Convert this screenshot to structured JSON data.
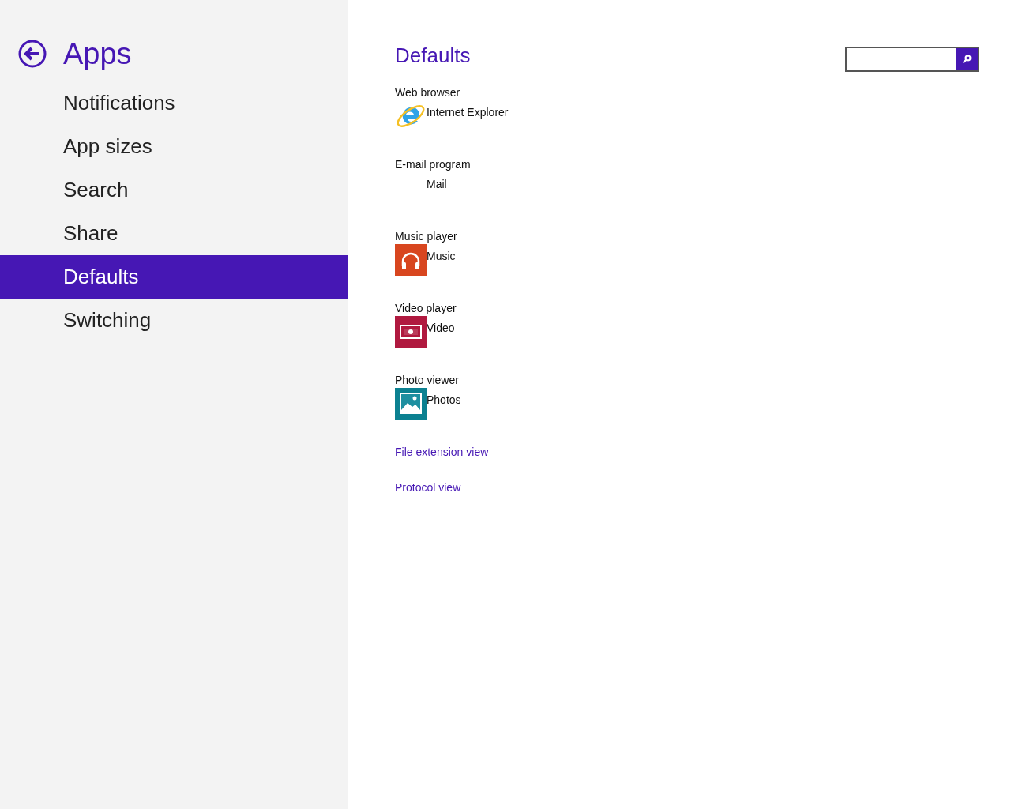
{
  "sidebar": {
    "title": "Apps",
    "items": [
      {
        "label": "Notifications",
        "selected": false
      },
      {
        "label": "App sizes",
        "selected": false
      },
      {
        "label": "Search",
        "selected": false
      },
      {
        "label": "Share",
        "selected": false
      },
      {
        "label": "Defaults",
        "selected": true
      },
      {
        "label": "Switching",
        "selected": false
      }
    ]
  },
  "main": {
    "title": "Defaults",
    "defaults": [
      {
        "label": "Web browser",
        "app": "Internet Explorer",
        "kind": "browser"
      },
      {
        "label": "E-mail program",
        "app": "Mail",
        "kind": "blank"
      },
      {
        "label": "Music player",
        "app": "Music",
        "kind": "music"
      },
      {
        "label": "Video player",
        "app": "Video",
        "kind": "video"
      },
      {
        "label": "Photo viewer",
        "app": "Photos",
        "kind": "photos"
      }
    ],
    "links": [
      "File extension view",
      "Protocol view"
    ]
  }
}
